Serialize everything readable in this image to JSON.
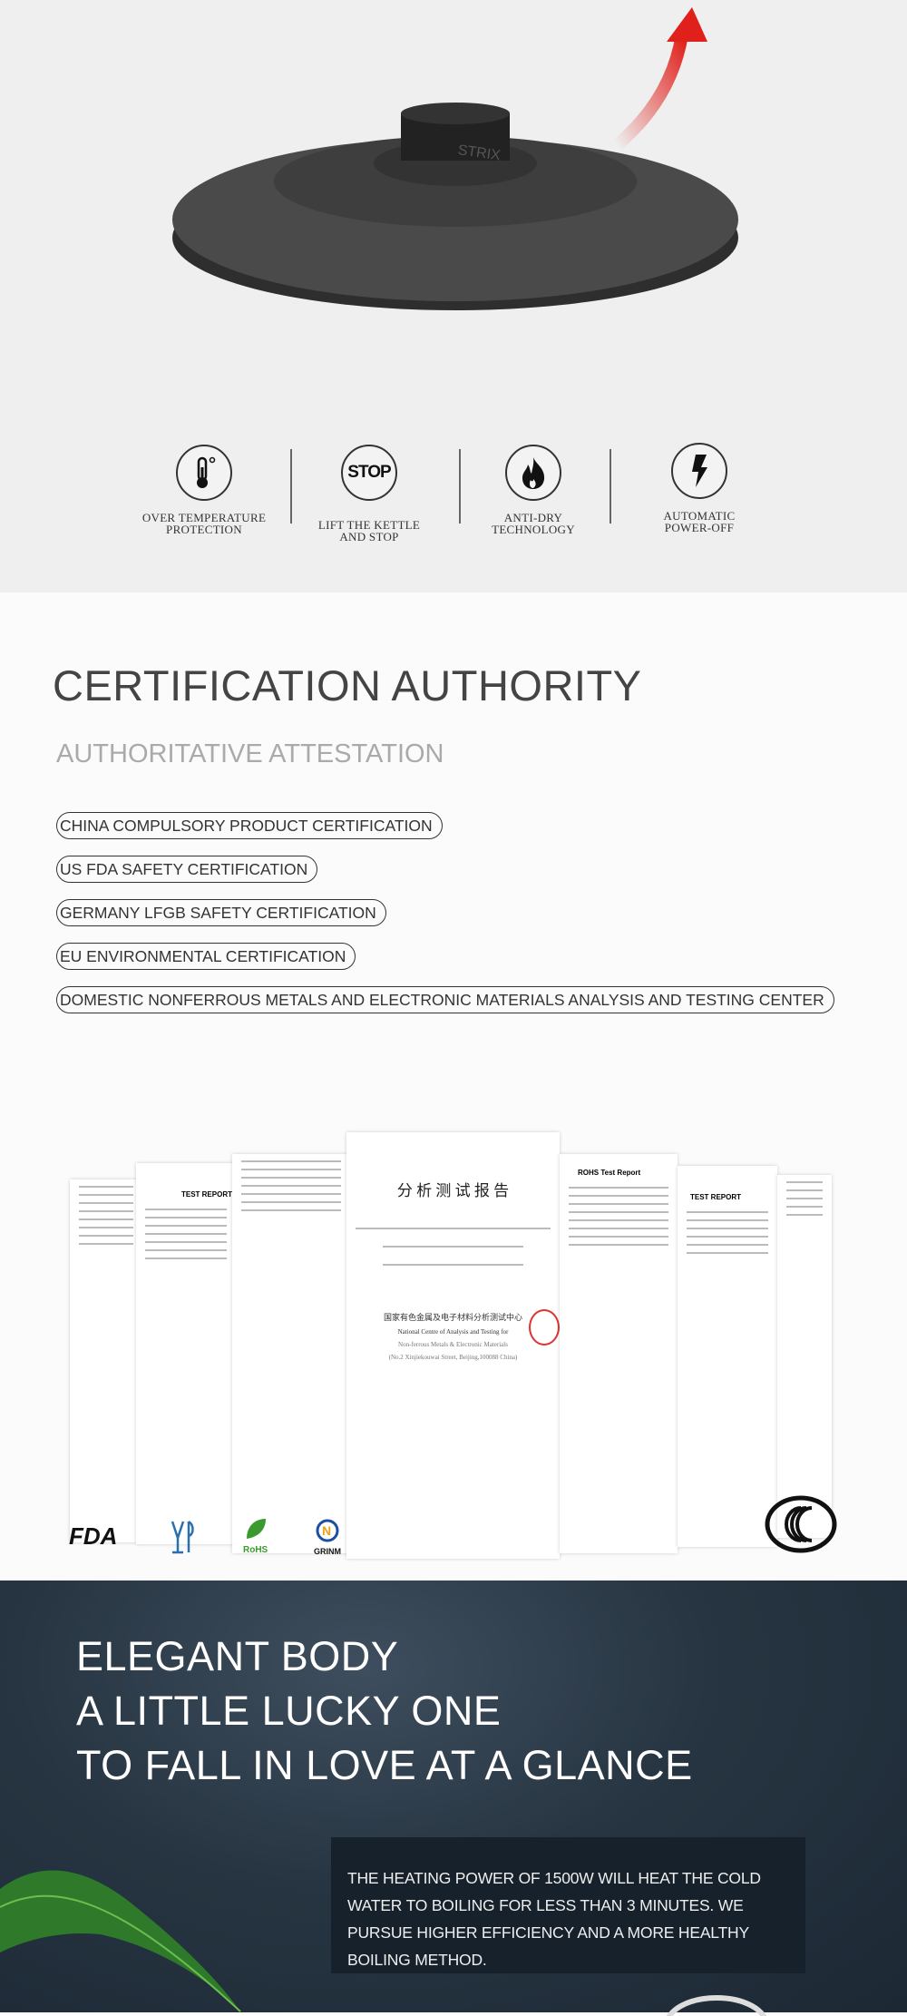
{
  "hero": {
    "brand_mark": "STRIX",
    "accent_color": "#e0201b",
    "features": [
      {
        "icon": "thermometer-icon",
        "label_line1": "OVER TEMPERATURE",
        "label_line2": "PROTECTION"
      },
      {
        "icon": "stop-icon",
        "icon_text": "STOP",
        "label_line1": "LIFT THE KETTLE",
        "label_line2": "AND STOP"
      },
      {
        "icon": "flame-icon",
        "label_line1": "ANTI-DRY",
        "label_line2": "TECHNOLOGY"
      },
      {
        "icon": "lightning-icon",
        "label_line1": "AUTOMATIC",
        "label_line2": "POWER-OFF"
      }
    ]
  },
  "certification": {
    "title": "CERTIFICATION AUTHORITY",
    "subtitle": "AUTHORITATIVE ATTESTATION",
    "items": [
      "CHINA COMPULSORY PRODUCT CERTIFICATION",
      "US FDA SAFETY CERTIFICATION",
      "GERMANY LFGB SAFETY CERTIFICATION",
      "EU ENVIRONMENTAL CERTIFICATION",
      "DOMESTIC NONFERROUS METALS AND ELECTRONIC MATERIALS ANALYSIS AND TESTING CENTER"
    ],
    "center_doc": {
      "title": "分 析 测 试 报 告",
      "org_cn": "国家有色金属及电子材料分析测试中心",
      "org_en1": "National Centre of Analysis and Testing for",
      "org_en2": "Non-ferrous Metals & Electronic Materials",
      "org_en3": "(No.2 Xinjiekouwai Street, Beijing,100088 China)"
    },
    "doc_headers": [
      "TEST REPORT",
      "ROHS Test Report",
      "TEST REPORT"
    ],
    "logos": [
      "FDA",
      "RoHS",
      "GRINM",
      "CCC"
    ]
  },
  "elegant": {
    "lines": [
      "ELEGANT BODY",
      "A LITTLE LUCKY ONE",
      "TO FALL IN LOVE AT A GLANCE"
    ],
    "description": "THE HEATING POWER OF 1500W WILL HEAT THE COLD WATER TO BOILING FOR LESS THAN 3 MINUTES. WE PURSUE HIGHER EFFICIENCY AND A MORE HEALTHY BOILING METHOD."
  }
}
